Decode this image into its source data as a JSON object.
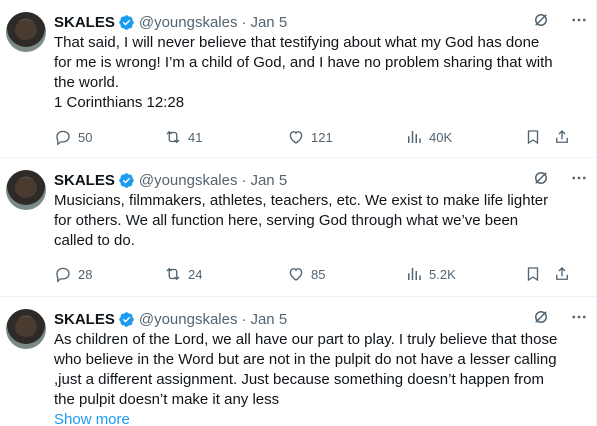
{
  "tweets": [
    {
      "name": "SKALES",
      "handle": "@youngskales",
      "dot": "·",
      "date": "Jan 5",
      "text": "That said, I will never believe that testifying about what my God has done\nfor me is wrong! I’m a child of God, and I have no problem sharing that with\nthe world.\n1 Corinthians 12:28",
      "replies": "50",
      "reposts": "41",
      "likes": "121",
      "views": "40K"
    },
    {
      "name": "SKALES",
      "handle": "@youngskales",
      "dot": "·",
      "date": "Jan 5",
      "text": "Musicians, filmmakers, athletes, teachers, etc. We exist to make life lighter\nfor others. We all function here, serving God through what we’ve been\ncalled to do.",
      "replies": "28",
      "reposts": "24",
      "likes": "85",
      "views": "5.2K"
    },
    {
      "name": "SKALES",
      "handle": "@youngskales",
      "dot": "·",
      "date": "Jan 5",
      "text": "As children of the Lord, we all have our part to play. I truly believe that those\nwho believe in the Word but are not in the pulpit do not have a lesser calling\n,just a different assignment. Just because something doesn’t happen from\nthe pulpit doesn’t make it any less",
      "show_more": "Show more"
    }
  ],
  "icons": {
    "verified": "verified-badge-icon",
    "grok": "grok-icon",
    "more": "more-icon",
    "reply": "reply-icon",
    "repost": "repost-icon",
    "like": "like-icon",
    "views": "views-icon",
    "bookmark": "bookmark-icon",
    "share": "share-icon"
  },
  "colors": {
    "verified": "#1d9bf0",
    "link": "#1d9bf0",
    "secondary_text": "#536471",
    "primary_text": "#0f1419"
  }
}
